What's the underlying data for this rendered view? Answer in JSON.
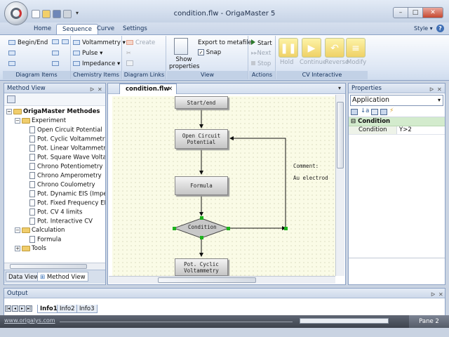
{
  "window": {
    "title": "condition.flw - OrigaMaster 5",
    "minimize": "–",
    "maximize": "□",
    "close": "✕"
  },
  "quick_access": {
    "more": "▾"
  },
  "ribbon_tabs": [
    "Home",
    "Sequence",
    "Curve",
    "Settings"
  ],
  "style_menu": "Style",
  "help": "?",
  "groups": {
    "diagram_items": {
      "label": "Diagram Items",
      "begin_end": "Begin/End"
    },
    "chemistry_items": {
      "label": "Chemistry Items",
      "voltammetry": "Voltammetry",
      "pulse": "Pulse",
      "impedance": "Impedance"
    },
    "diagram_links": {
      "label": "Diagram Links",
      "create": "Create"
    },
    "view": {
      "label": "View",
      "show_properties": "Show properties",
      "export": "Export to metafile",
      "snap": "Snap",
      "snap_checked": true
    },
    "actions": {
      "label": "Actions",
      "start": "Start",
      "next": "Next",
      "stop": "Stop"
    },
    "cv_interactive": {
      "label": "CV Interactive",
      "hold": "Hold",
      "continue": "Continue",
      "reverse": "Reverse",
      "modify": "Modify"
    }
  },
  "method_view": {
    "title": "Method View",
    "pin": "ᐅ",
    "close": "✕",
    "root": "OrigaMaster Methodes",
    "experiment": "Experiment",
    "items": [
      "Open Circuit Potential",
      "Pot. Cyclic Voltammetry",
      "Pot. Linear Voltammetry",
      "Pot. Square Wave Volta...",
      "Chrono Potentiometry",
      "Chrono Amperometry",
      "Chrono Coulometry",
      "Pot. Dynamic EIS (Impe...",
      "Pot. Fixed Frequency EIS",
      "Pot. CV 4 limits",
      "Pot. Interactive CV"
    ],
    "calculation": "Calculation",
    "formula": "Formula",
    "tools": "Tools",
    "bottom_tabs": [
      "Data View",
      "Method View"
    ]
  },
  "document": {
    "tab": "condition.flw",
    "tab_close": "✕",
    "nodes": {
      "start": "Start/end",
      "ocp": "Open Circuit\nPotential",
      "formula": "Formula",
      "condition": "Condition",
      "pcv": "Pot. Cyclic\nVoltammetry"
    },
    "comment_label": "Comment:",
    "comment_text": "Au electrod"
  },
  "properties": {
    "title": "Properties",
    "pin": "ᐅ",
    "close": "✕",
    "selector": "Application",
    "category": "Condition",
    "rows": [
      {
        "name": "Condition",
        "value": "Y>2"
      }
    ]
  },
  "output": {
    "title": "Output",
    "pin": "ᐅ",
    "close": "✕",
    "tabs": [
      "Info1",
      "Info2",
      "Info3"
    ]
  },
  "status": {
    "link": "www.origalys.com",
    "pane": "Pane 2"
  }
}
